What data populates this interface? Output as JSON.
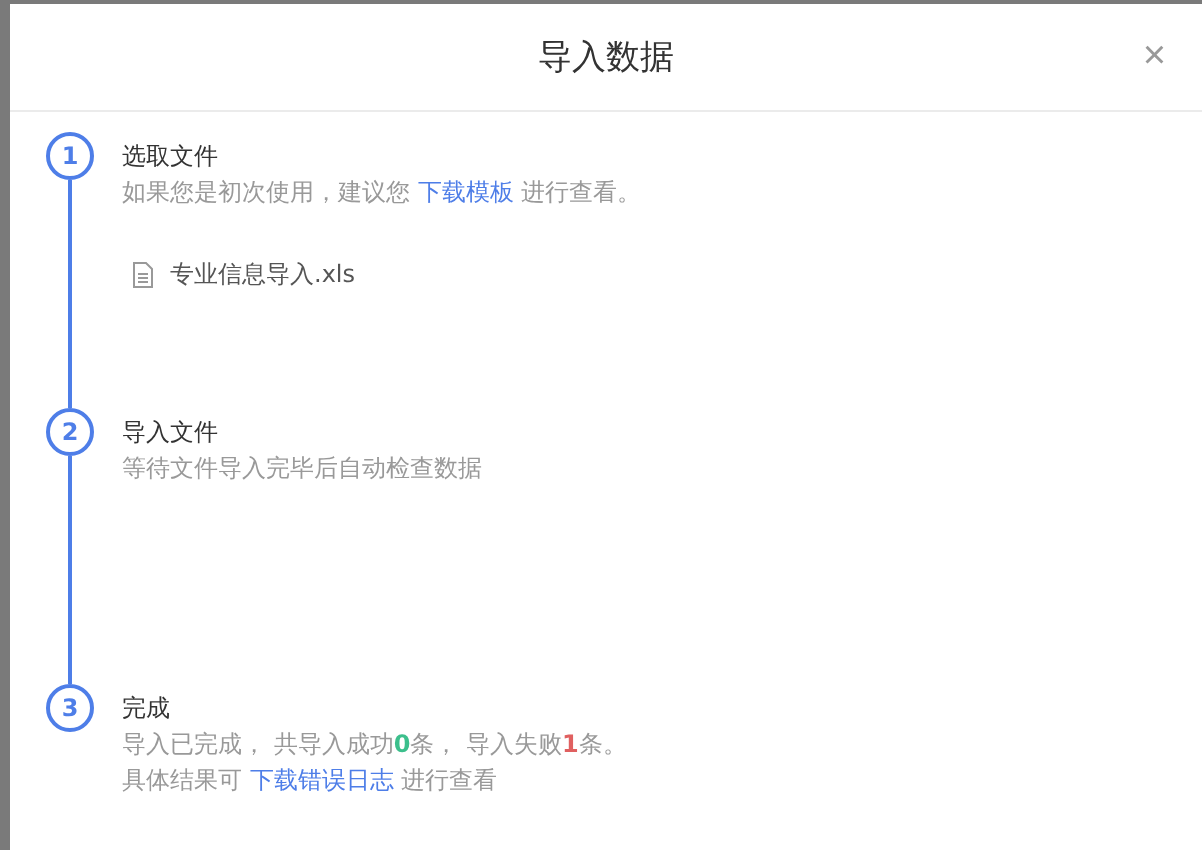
{
  "dialog": {
    "title": "导入数据",
    "close": "×"
  },
  "steps": [
    {
      "number": "1",
      "title": "选取文件",
      "lines": [
        [
          {
            "kind": "text",
            "text": "如果您是初次使用，建议您 "
          },
          {
            "kind": "link",
            "text": "下载模板"
          },
          {
            "kind": "text",
            "text": " 进行查看。"
          }
        ]
      ],
      "file": "专业信息导入.xls"
    },
    {
      "number": "2",
      "title": "导入文件",
      "lines": [
        [
          {
            "kind": "text",
            "text": "等待文件导入完毕后自动检查数据"
          }
        ]
      ]
    },
    {
      "number": "3",
      "title": "完成",
      "lines": [
        [
          {
            "kind": "text",
            "text": "导入已完成， 共导入成功"
          },
          {
            "kind": "success",
            "text": "0"
          },
          {
            "kind": "text",
            "text": "条， 导入失败"
          },
          {
            "kind": "error",
            "text": "1"
          },
          {
            "kind": "text",
            "text": "条。"
          }
        ],
        [
          {
            "kind": "text",
            "text": "具体结果可 "
          },
          {
            "kind": "link",
            "text": "下载错误日志"
          },
          {
            "kind": "text",
            "text": " 进行查看"
          }
        ]
      ]
    }
  ]
}
